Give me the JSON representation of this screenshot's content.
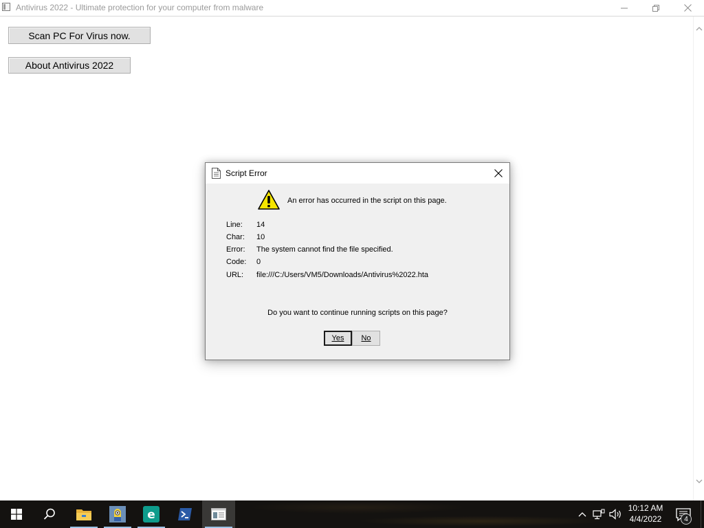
{
  "window": {
    "title": "Antivirus 2022 - Ultimate protection for your computer from malware",
    "icon": "hta-app-icon",
    "controls": [
      "minimize-icon",
      "maximize-icon",
      "close-icon"
    ]
  },
  "content": {
    "scan_button": "Scan PC For Virus now.",
    "about_button": "About Antivirus 2022"
  },
  "dialog": {
    "title": "Script Error",
    "message": "An error has occurred in the script on this page.",
    "fields": [
      {
        "label": "Line:",
        "value": "14"
      },
      {
        "label": "Char:",
        "value": "10"
      },
      {
        "label": "Error:",
        "value": "The system cannot find the file specified."
      },
      {
        "label": "Code:",
        "value": "0"
      },
      {
        "label": "URL:",
        "value": "file:///C:/Users/VM5/Downloads/Antivirus%2022.hta"
      }
    ],
    "question": "Do you want to continue running scripts on this page?",
    "yes_button": "Yes",
    "no_button": "No"
  },
  "taskbar": {
    "apps": [
      "start-icon",
      "search-icon",
      "file-explorer-icon",
      "minion-app-icon",
      "edge-icon",
      "powershell-icon",
      "hta-app-icon"
    ],
    "clock_time": "10:12 AM",
    "clock_date": "4/4/2022",
    "notification_count": "4"
  },
  "colors": {
    "taskbar_bg": "#141210",
    "dialog_bg": "#f0f0f0",
    "button_bg": "#e1e1e1",
    "warning_yellow": "#f5e500",
    "accent_blue": "#0078d7"
  }
}
